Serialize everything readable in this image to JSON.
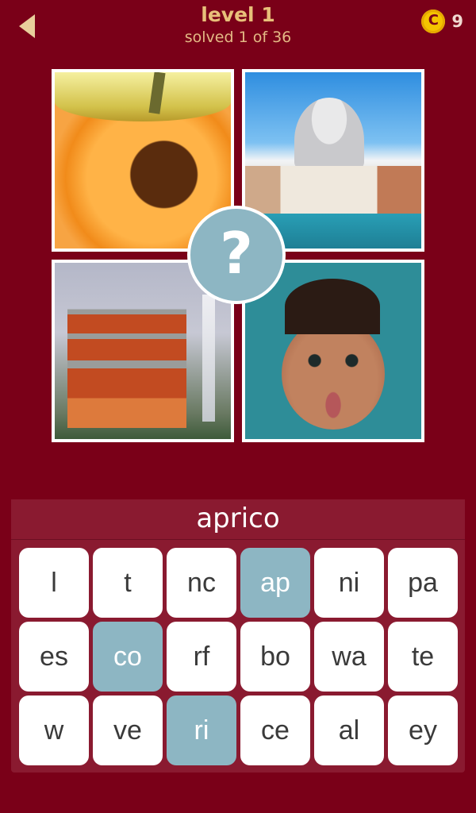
{
  "header": {
    "back_icon": "back-arrow-icon",
    "title": "level 1",
    "subtitle": "solved 1 of 36",
    "coin_symbol": "C",
    "coin_count": "9"
  },
  "center_icon": "?",
  "answer": "aprico",
  "keys": [
    {
      "label": "l",
      "used": false
    },
    {
      "label": "t",
      "used": false
    },
    {
      "label": "nc",
      "used": false
    },
    {
      "label": "ap",
      "used": true
    },
    {
      "label": "ni",
      "used": false
    },
    {
      "label": "pa",
      "used": false
    },
    {
      "label": "es",
      "used": false
    },
    {
      "label": "co",
      "used": true
    },
    {
      "label": "rf",
      "used": false
    },
    {
      "label": "bo",
      "used": false
    },
    {
      "label": "wa",
      "used": false
    },
    {
      "label": "te",
      "used": false
    },
    {
      "label": "w",
      "used": false
    },
    {
      "label": "ve",
      "used": false
    },
    {
      "label": "ri",
      "used": true
    },
    {
      "label": "ce",
      "used": false
    },
    {
      "label": "al",
      "used": false
    },
    {
      "label": "ey",
      "used": false
    }
  ],
  "colors": {
    "background": "#7a0018",
    "panel": "#8a1a30",
    "used_key": "#8db6c3",
    "title": "#e8c07a",
    "coin": "#f5c400"
  }
}
